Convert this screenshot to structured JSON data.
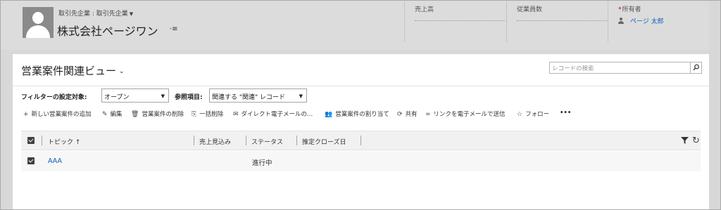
{
  "header": {
    "entity_type": "取引先企業 : 取引先企業",
    "record_name": "株式会社ページワン",
    "fields": [
      {
        "label": "売上高",
        "value": ""
      },
      {
        "label": "従業員数",
        "value": ""
      },
      {
        "label": "所有者",
        "required": "*",
        "value": "ページ 太郎"
      }
    ]
  },
  "view": {
    "title": "営業案件関連ビュー",
    "search_placeholder": "レコードの検索"
  },
  "filter": {
    "filter_label": "フィルターの設定対象:",
    "filter_value": "オープン",
    "ref_label": "参照項目:",
    "ref_value": "関連する \"関連\" レコード"
  },
  "toolbar": {
    "new": "新しい営業案件の追加",
    "edit": "編集",
    "delete": "営業案件の削除",
    "bulk_delete": "一括削除",
    "email": "ダイレクト電子メールの...",
    "assign": "営業案件の割り当て",
    "share": "共有",
    "email_link": "リンクを電子メールで送信",
    "follow": "フォロー",
    "more": "•••"
  },
  "grid": {
    "columns": [
      "トピック ↑",
      "売上見込み",
      "ステータス",
      "推定クローズ日"
    ],
    "rows": [
      {
        "topic": "AAA",
        "revenue": "",
        "status": "進行中",
        "close_date": ""
      }
    ]
  }
}
